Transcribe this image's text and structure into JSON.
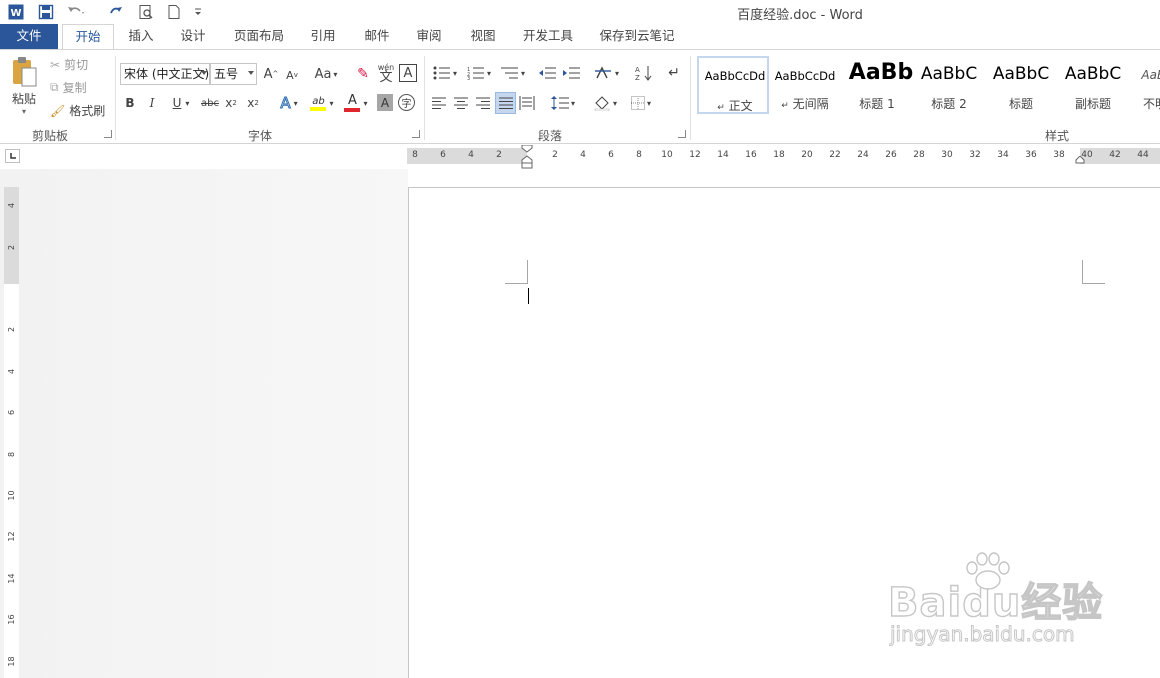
{
  "window": {
    "title": "百度经验.doc - Word"
  },
  "qat": {
    "icons": [
      "word-icon",
      "save-icon",
      "undo-icon",
      "redo-icon",
      "print-preview-icon",
      "new-document-icon",
      "customize-qat-icon"
    ]
  },
  "tabs": {
    "file": "文件",
    "home": "开始",
    "insert": "插入",
    "design": "设计",
    "layout": "页面布局",
    "references": "引用",
    "mailings": "邮件",
    "review": "审阅",
    "view": "视图",
    "developer": "开发工具",
    "cloud": "保存到云笔记"
  },
  "clipboard": {
    "paste": "粘贴",
    "cut": "剪切",
    "copy": "复制",
    "format_painter": "格式刷",
    "label": "剪贴板"
  },
  "font": {
    "font_name": "宋体 (中文正文)",
    "font_size": "五号",
    "grow": "A",
    "shrink": "A",
    "change_case": "Aa",
    "phonetic": "wén",
    "bold": "B",
    "italic": "I",
    "underline": "U",
    "strikethrough": "abc",
    "subscript": "x",
    "superscript": "x",
    "highlight": "ab",
    "font_color": "A",
    "shading": "A",
    "enclose": "字",
    "label": "字体"
  },
  "paragraph": {
    "label": "段落"
  },
  "styles": {
    "label": "样式",
    "items": [
      {
        "sample": "AaBbCcDd",
        "name": "正文",
        "mark": "↵"
      },
      {
        "sample": "AaBbCcDd",
        "name": "无间隔",
        "mark": "↵"
      },
      {
        "sample": "AaBb",
        "name": "标题 1"
      },
      {
        "sample": "AaBbC",
        "name": "标题 2"
      },
      {
        "sample": "AaBbC",
        "name": "标题"
      },
      {
        "sample": "AaBbC",
        "name": "副标题"
      },
      {
        "sample": "AaBl",
        "name": "不明"
      }
    ]
  },
  "ruler": {
    "ticks": [
      "8",
      "6",
      "4",
      "2",
      "2",
      "4",
      "6",
      "8",
      "10",
      "12",
      "14",
      "16",
      "18",
      "20",
      "22",
      "24",
      "26",
      "28",
      "30",
      "32",
      "34",
      "36",
      "38",
      "40",
      "42",
      "44"
    ],
    "vticks": [
      "4",
      "2",
      "2",
      "4",
      "6",
      "8",
      "10",
      "12",
      "14",
      "16",
      "18"
    ]
  },
  "watermark": {
    "logo": "Baidu经验",
    "url": "jingyan.baidu.com"
  },
  "colors": {
    "accent": "#2b579a",
    "highlight": "#ffff00",
    "font_color": "#e0262e"
  }
}
